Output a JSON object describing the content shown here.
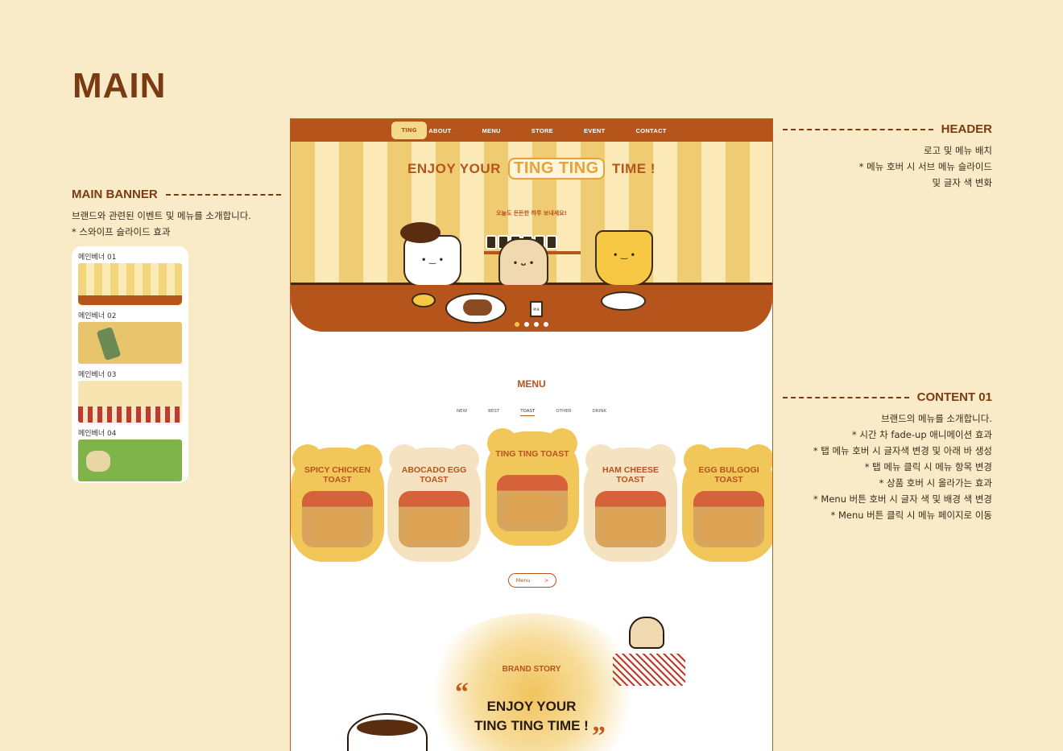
{
  "page_heading": "MAIN",
  "left_annotation": {
    "title": "MAIN BANNER",
    "lines": [
      "브랜드와 관련된 이벤트 및 메뉴를 소개합니다.",
      "* 스와이프 슬라이드 효과"
    ],
    "thumbnails": [
      {
        "label": "메인베너 01"
      },
      {
        "label": "메인베너 02"
      },
      {
        "label": "메인베너 03"
      },
      {
        "label": "메인베너 04"
      }
    ]
  },
  "header_annotation": {
    "title": "HEADER",
    "lines": [
      "로고 및 메뉴 배치",
      "* 메뉴 호버 시 서브 메뉴 슬라이드",
      "및 글자 색 변화"
    ]
  },
  "content_annotation": {
    "title": "CONTENT 01",
    "lines": [
      "브랜드의 메뉴를 소개합니다.",
      "* 시간 차 fade-up 애니메이션 효과",
      "* 탭 메뉴 호버 시 글자색 변경 및 아래 바 생성",
      "* 탭 메뉴 클릭 시 메뉴 항목 변경",
      "* 상품 호버 시 올라가는 효과",
      "* Menu 버튼 호버 시 글자 색 및 배경 색 변경",
      "* Menu 버튼 클릭 시 메뉴 페이지로 이동"
    ]
  },
  "site": {
    "nav": {
      "items": [
        "ABOUT",
        "MENU",
        "STORE",
        "EVENT",
        "CONTACT"
      ]
    },
    "banner": {
      "title_left": "ENJOY YOUR",
      "title_ting": "TING TING",
      "title_right": "TIME !",
      "subtitle": "오늘도 든든한 하루 보내세요!",
      "milk_label": "Milk",
      "slide_count": 4,
      "active_slide": 1
    },
    "menu": {
      "title": "MENU",
      "tabs": [
        "NEW",
        "BEST",
        "TOAST",
        "OTHER",
        "DRINK"
      ],
      "active_tab": "TOAST",
      "products": [
        {
          "name": "SPICY CHICKEN TOAST"
        },
        {
          "name": "ABOCADO EGG TOAST"
        },
        {
          "name": "TING TING TOAST"
        },
        {
          "name": "HAM CHEESE TOAST"
        },
        {
          "name": "EGG BULGOGI TOAST"
        }
      ],
      "button_label": "Menu",
      "button_arrow": ">"
    },
    "brand_story": {
      "label": "BRAND STORY",
      "heading_line1": "ENJOY YOUR",
      "heading_line2": "TING TING TIME !",
      "quote_open": "“",
      "quote_close": "”"
    }
  },
  "colors": {
    "background": "#f9ebc8",
    "brand_brown": "#b5541b",
    "heading_brown": "#7a3b12",
    "accent_yellow": "#f2c759"
  }
}
